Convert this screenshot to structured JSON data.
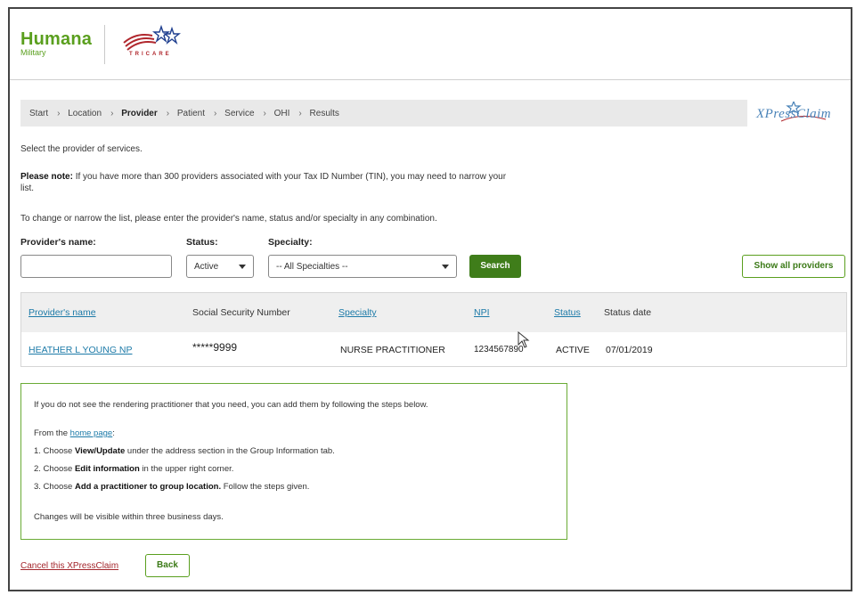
{
  "header": {
    "brand_name": "Humana",
    "brand_sub": "Military",
    "partner_logo_text": "TRICARE"
  },
  "breadcrumb": {
    "items": [
      "Start",
      "Location",
      "Provider",
      "Patient",
      "Service",
      "OHI",
      "Results"
    ],
    "current": "Provider",
    "separator": "›"
  },
  "xpress_logo": "XPressClaim",
  "intro": {
    "select_text": "Select the provider of services.",
    "note_label": "Please note:",
    "note_text_line1": " If you have more than 300 providers associated with your Tax ID Number (TIN), you may need to narrow your",
    "note_text_line2": "list.",
    "narrow_text": "To change or narrow the list, please enter the provider's name, status and/or specialty in any combination."
  },
  "filters": {
    "name_label": "Provider's name:",
    "name_value": "",
    "status_label": "Status:",
    "status_value": "Active",
    "specialty_label": "Specialty:",
    "specialty_value": "-- All Specialties --",
    "search_label": "Search",
    "show_all_label": "Show all providers"
  },
  "table": {
    "headers": {
      "name": "Provider's name",
      "ssn": "Social Security Number",
      "specialty": "Specialty",
      "npi": "NPI",
      "status": "Status",
      "status_date": "Status date"
    },
    "rows": [
      {
        "name": "HEATHER L YOUNG NP",
        "ssn": "*****9999",
        "specialty": "NURSE PRACTITIONER",
        "npi": "1234567890",
        "status": "ACTIVE",
        "status_date": "07/01/2019"
      }
    ]
  },
  "info": {
    "intro": "If you do not see the rendering practitioner that you need, you can add them by following the steps below.",
    "from_prefix": "From the ",
    "home_link": "home page",
    "from_suffix": ":",
    "step1_prefix": "1. Choose ",
    "step1_bold": "View/Update",
    "step1_suffix": " under the address section in the Group Information tab.",
    "step2_prefix": "2. Choose ",
    "step2_bold": "Edit information",
    "step2_suffix": " in the upper right corner.",
    "step3_prefix": "3. Choose ",
    "step3_bold": "Add a practitioner to group location.",
    "step3_suffix": " Follow the steps given.",
    "footer": "Changes will be visible within three business days."
  },
  "footer": {
    "cancel_label": "Cancel this XPressClaim",
    "back_label": "Back"
  },
  "colors": {
    "brand_green": "#5a9f1e",
    "button_green": "#3f7d1a",
    "link_blue": "#1c7aa8",
    "cancel_red": "#a4262c"
  }
}
